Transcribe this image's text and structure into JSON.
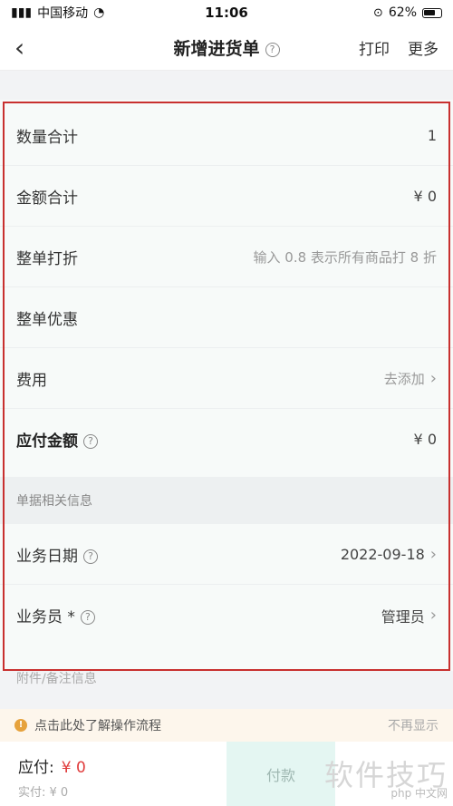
{
  "status_bar": {
    "carrier": "中国移动",
    "time": "11:06",
    "battery": "62%"
  },
  "nav": {
    "title": "新增进货单",
    "print": "打印",
    "more": "更多"
  },
  "rows": {
    "quantity_total": {
      "label": "数量合计",
      "value": "1"
    },
    "amount_total": {
      "label": "金额合计",
      "value": "¥ 0"
    },
    "discount": {
      "label": "整单打折",
      "placeholder": "输入 0.8 表示所有商品打 8 折"
    },
    "promotion": {
      "label": "整单优惠",
      "value": ""
    },
    "fees": {
      "label": "费用",
      "value": "去添加"
    },
    "payable": {
      "label": "应付金额",
      "value": "¥ 0"
    }
  },
  "section_document_info": "单据相关信息",
  "business_date": {
    "label": "业务日期",
    "value": "2022-09-18"
  },
  "salesperson": {
    "label": "业务员 *",
    "value": "管理员"
  },
  "attachments_label": "附件/备注信息",
  "tip": {
    "text": "点击此处了解操作流程",
    "dismiss": "不再显示"
  },
  "bottom": {
    "due_label": "应付:",
    "due_amount": "¥ 0",
    "paid_line": "实付: ¥ 0",
    "pay_button": "付款"
  },
  "watermark": {
    "main": "软件技巧",
    "small": "php 中文网"
  },
  "colors": {
    "accent_red": "#e03c3c",
    "highlight_border": "#c8302f",
    "pay_button_bg": "#e4f6f2"
  }
}
